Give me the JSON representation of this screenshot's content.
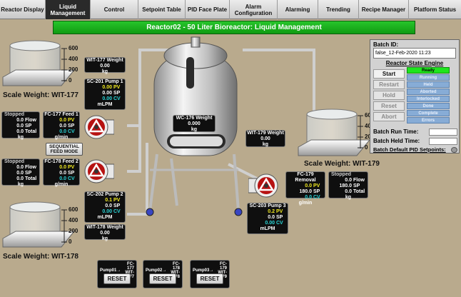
{
  "nav": {
    "tabs": [
      {
        "label": "Reactor Display",
        "active": false
      },
      {
        "label": "Liquid\nManagement",
        "active": true
      },
      {
        "label": "Control",
        "active": false
      },
      {
        "label": "Setpoint Table",
        "active": false
      },
      {
        "label": "PID Face Plate",
        "active": false
      },
      {
        "label": "Alarm\nConfiguration",
        "active": false
      },
      {
        "label": "Alarming",
        "active": false
      },
      {
        "label": "Trending",
        "active": false
      },
      {
        "label": "Recipe Manager",
        "active": false
      },
      {
        "label": "Platform Status",
        "active": false
      }
    ]
  },
  "title": "Reactor02 - 50 Liter Bioreactor: Liquid Management",
  "scales": {
    "ticks": [
      "600",
      "400",
      "200",
      "0"
    ],
    "wit177_label": "Scale Weight: WIT-177",
    "wit179_label": "Scale Weight: WIT-179",
    "wit178_label": "Scale Weight: WIT-178"
  },
  "wit177": {
    "title": "WIT-177 Weight",
    "value": "0.00",
    "unit": "kg"
  },
  "wit178": {
    "title": "WIT-178 Weight",
    "value": "0.00",
    "unit": "kg"
  },
  "wit179": {
    "title": "WIT-179 Weight",
    "value": "0.00",
    "unit": "kg"
  },
  "wc176": {
    "title": "WC-176 Weight",
    "value": "0.000",
    "unit": "kg"
  },
  "pump1": {
    "title": "SC-201 Pump 1",
    "pv": "0.00",
    "sp": "0.00",
    "cv": "0.00",
    "pv_l": "PV",
    "sp_l": "SP",
    "cv_l": "CV",
    "unit": "mLPM"
  },
  "pump2": {
    "title": "SC-202 Pump 2",
    "pv": "0.1",
    "sp": "0.0",
    "cv": "0.00",
    "pv_l": "PV",
    "sp_l": "SP",
    "cv_l": "CV",
    "unit": "mLPM"
  },
  "pump3": {
    "title": "SC-203 Pump 3",
    "pv": "0.2",
    "sp": "0.0",
    "cv": "0.00",
    "pv_l": "PV",
    "sp_l": "SP",
    "cv_l": "CV",
    "unit": "mLPM"
  },
  "fc177": {
    "title": "FC-177 Feed 1",
    "pv": "0.0",
    "sp": "0.0",
    "cv": "0.0",
    "pv_l": "PV",
    "sp_l": "SP",
    "cv_l": "CV",
    "unit": "g/min"
  },
  "fc178": {
    "title": "FC-178 Feed 2",
    "pv": "0.0",
    "sp": "0.0",
    "cv": "0.0",
    "pv_l": "PV",
    "sp_l": "SP",
    "cv_l": "CV",
    "unit": "g/min"
  },
  "fc179": {
    "title": "FC-179 Removal",
    "pv": "0.0",
    "sp": "180.0",
    "cv": "0.0",
    "pv_l": "PV",
    "sp_l": "SP",
    "cv_l": "CV",
    "unit": "g/min"
  },
  "tot177": {
    "status": "Stopped",
    "flow": "0.0",
    "sp": "0.0",
    "total": "0.0",
    "flow_l": "Flow",
    "sp_l": "SP",
    "total_l": "Total",
    "unit": "kg"
  },
  "tot178": {
    "status": "Stopped",
    "flow": "0.0",
    "sp": "0.0",
    "total": "0.0",
    "flow_l": "Flow",
    "sp_l": "SP",
    "total_l": "Total",
    "unit": "kg"
  },
  "tot179": {
    "status": "Stopped",
    "flow": "0.0",
    "sp": "180.0",
    "total": "0.0",
    "flow_l": "Flow",
    "sp_l": "SP",
    "total_l": "Total",
    "unit": "kg"
  },
  "seq_button": "SEQUENTIAL\nFEED MODE",
  "resets": [
    {
      "pump": "Pump01",
      "arrow": "→",
      "fc": "FC-177",
      "wit": "WIT-177",
      "label": "RESET"
    },
    {
      "pump": "Pump02",
      "arrow": "→",
      "fc": "FC-178",
      "wit": "WIT-178",
      "label": "RESET"
    },
    {
      "pump": "Pump03",
      "arrow": "→",
      "fc": "FC-179",
      "wit": "WIT-179",
      "label": "RESET"
    }
  ],
  "panel": {
    "batch_id_label": "Batch ID:",
    "batch_id_value": "false_12-Feb-2020 11:23",
    "engine_label": "Reactor State Engine",
    "buttons": [
      "Start",
      "Restart",
      "Hold",
      "Reset",
      "Abort"
    ],
    "states": [
      "Ready",
      "Running",
      "Held",
      "Aborted",
      "Interlocked",
      "Done",
      "Complete",
      "Errors"
    ],
    "run_time_label": "Batch Run Time:",
    "held_time_label": "Batch Held Time:",
    "pid_label": "Batch Default PID Setpoints:"
  },
  "colors": {
    "pv": "#f1ea22",
    "cv": "#29d6d8",
    "title_green": "#1ab31c",
    "ready": "#1ee51e"
  }
}
